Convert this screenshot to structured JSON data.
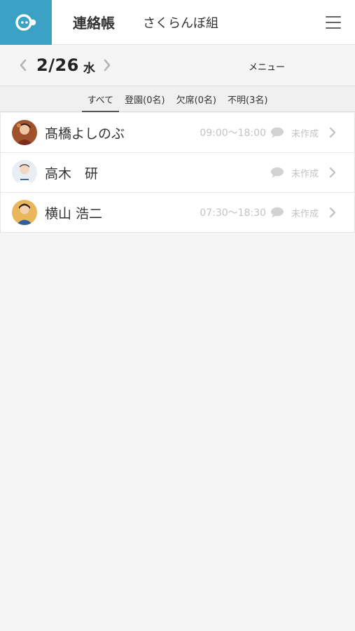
{
  "header": {
    "app_title": "連絡帳",
    "class_name": "さくらんぼ組",
    "brand_color": "#3ba2c5"
  },
  "datebar": {
    "date": "2/26",
    "day_of_week": "水",
    "menu_label": "メニュー"
  },
  "tabs": [
    {
      "label": "すべて",
      "active": true
    },
    {
      "label": "登園(0名)",
      "active": false
    },
    {
      "label": "欠席(0名)",
      "active": false
    },
    {
      "label": "不明(3名)",
      "active": false
    }
  ],
  "children": [
    {
      "name": "髙橋よしのぶ",
      "time": "09:00〜18:00",
      "status": "未作成"
    },
    {
      "name": "高木　研",
      "time": "",
      "status": "未作成"
    },
    {
      "name": "横山 浩二",
      "time": "07:30〜18:30",
      "status": "未作成"
    }
  ]
}
